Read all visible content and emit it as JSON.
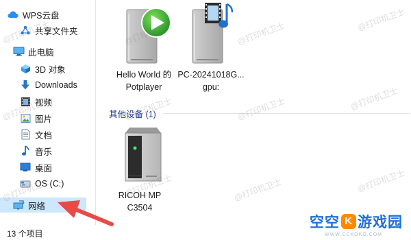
{
  "sidebar": {
    "items": [
      {
        "label": "WPS云盘"
      },
      {
        "label": "共享文件夹"
      },
      {
        "label": "此电脑"
      },
      {
        "label": "3D 对象"
      },
      {
        "label": "Downloads"
      },
      {
        "label": "视频"
      },
      {
        "label": "图片"
      },
      {
        "label": "文档"
      },
      {
        "label": "音乐"
      },
      {
        "label": "桌面"
      },
      {
        "label": "OS (C:)"
      },
      {
        "label": "网络",
        "selected": true
      }
    ]
  },
  "content": {
    "media_devices": [
      {
        "label_line1": "Hello World 的",
        "label_line2": "Potplayer",
        "icon": "potplayer-device-icon"
      },
      {
        "label_line1": "PC-20241018G...",
        "label_line2": "gpu:",
        "icon": "media-server-icon"
      }
    ],
    "group_header": "其他设备 (1)",
    "other_devices": [
      {
        "label_line1": "RICOH MP",
        "label_line2": "C3504",
        "icon": "printer-device-icon"
      }
    ]
  },
  "status_bar": {
    "item_count": "13 个项目"
  },
  "watermark": {
    "text": "@打印机卫士"
  },
  "brand": {
    "part1": "空空",
    "badge": "K",
    "part2": "游戏园",
    "url": "WWW.CCKOKO.COM"
  },
  "colors": {
    "selected_bg": "#cce8ff",
    "arrow": "#e94a46",
    "group_header": "#1e3e8c",
    "brand": "#1e6fd8"
  }
}
